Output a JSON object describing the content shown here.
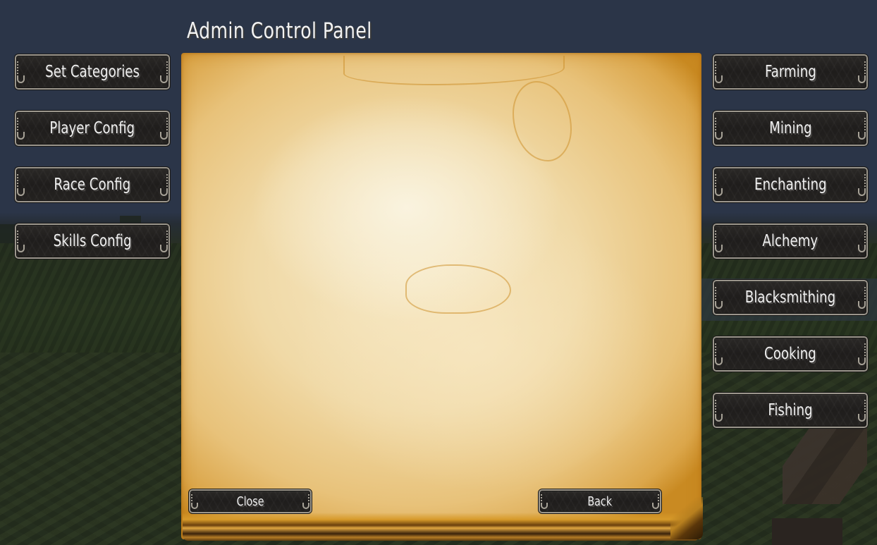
{
  "header": {
    "title": "Admin Control Panel"
  },
  "left_menu": {
    "items": [
      {
        "label": "Set Categories"
      },
      {
        "label": "Player Config"
      },
      {
        "label": "Race Config"
      },
      {
        "label": "Skills Config"
      }
    ]
  },
  "right_menu": {
    "items": [
      {
        "label": "Farming"
      },
      {
        "label": "Mining"
      },
      {
        "label": "Enchanting"
      },
      {
        "label": "Alchemy"
      },
      {
        "label": "Blacksmithing"
      },
      {
        "label": "Cooking"
      },
      {
        "label": "Fishing"
      }
    ]
  },
  "panel": {
    "close_label": "Close",
    "back_label": "Back"
  },
  "colors": {
    "sky": "#2a3447",
    "button_face": "#211f1e",
    "button_border": "#9b968c",
    "button_text": "#efefef",
    "parchment_light": "#f6e8c5",
    "parchment_edge": "#c98a22"
  }
}
